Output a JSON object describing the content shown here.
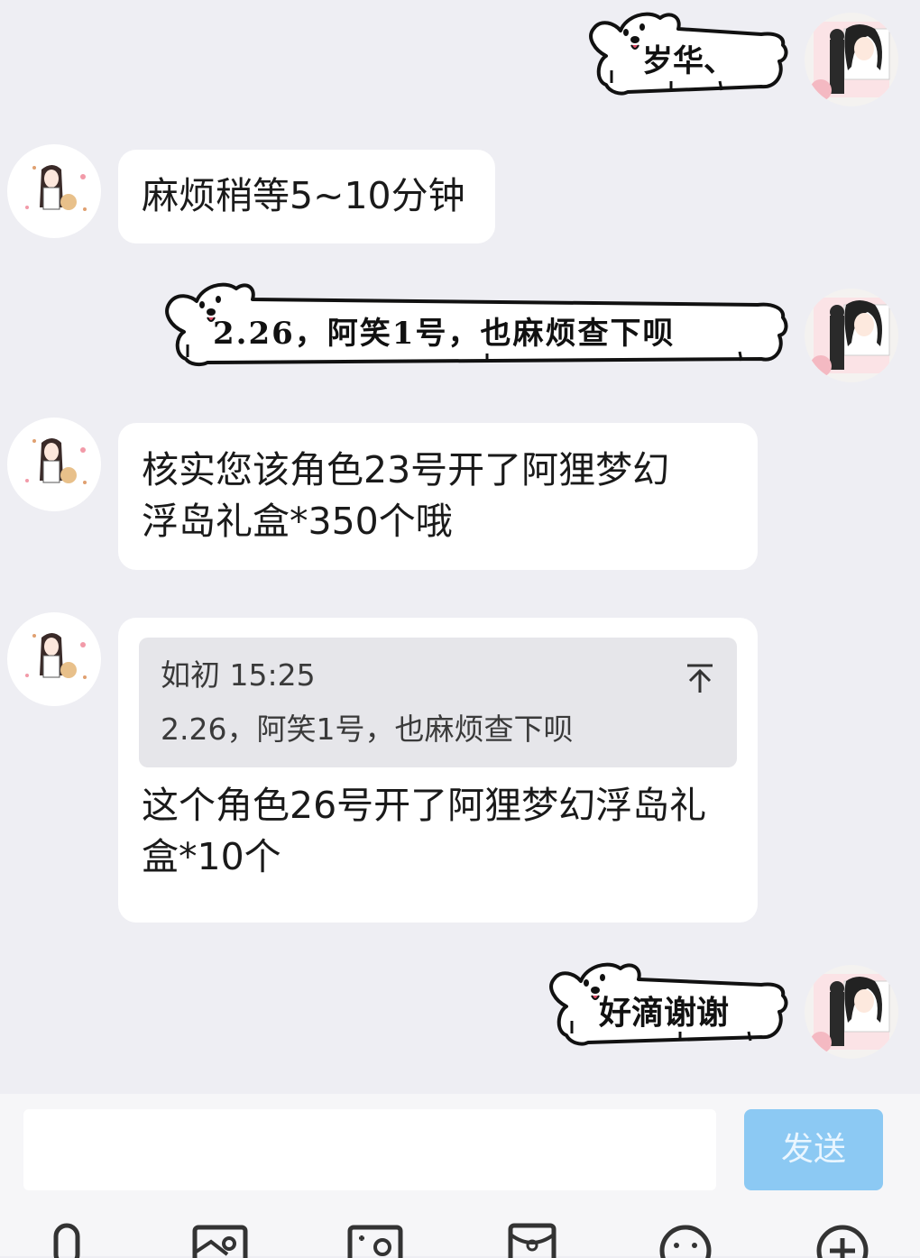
{
  "messages": [
    {
      "id": "m1",
      "side": "right",
      "type": "sticker",
      "text": "岁华、"
    },
    {
      "id": "m2",
      "side": "left",
      "type": "text",
      "lines": [
        "麻烦稍等5~10分钟"
      ]
    },
    {
      "id": "m3",
      "side": "right",
      "type": "sticker",
      "text": "2.26，阿笑1号，也麻烦查下呗"
    },
    {
      "id": "m4",
      "side": "left",
      "type": "text",
      "lines": [
        "核实您该角色23号开了阿狸梦幻",
        "浮岛礼盒*350个哦"
      ]
    },
    {
      "id": "m5",
      "side": "left",
      "type": "reply",
      "quote": {
        "author": "如初",
        "time": "15:25",
        "text": "2.26，阿笑1号，也麻烦查下呗"
      },
      "lines": [
        "这个角色26号开了阿狸梦幻浮岛礼",
        "盒*10个"
      ]
    },
    {
      "id": "m6",
      "side": "right",
      "type": "sticker",
      "text": "好滴谢谢"
    }
  ],
  "input": {
    "value": "",
    "send_label": "发送"
  },
  "toolbar": [
    {
      "name": "voice-icon"
    },
    {
      "name": "image-icon"
    },
    {
      "name": "camera-icon"
    },
    {
      "name": "red-packet-icon"
    },
    {
      "name": "emoji-icon"
    },
    {
      "name": "plus-icon"
    }
  ],
  "colors": {
    "chat_bg": "#eeeef3",
    "bubble_bg": "#ffffff",
    "quote_bg": "#e6e6ea",
    "send_button": "#8cc9f3"
  }
}
